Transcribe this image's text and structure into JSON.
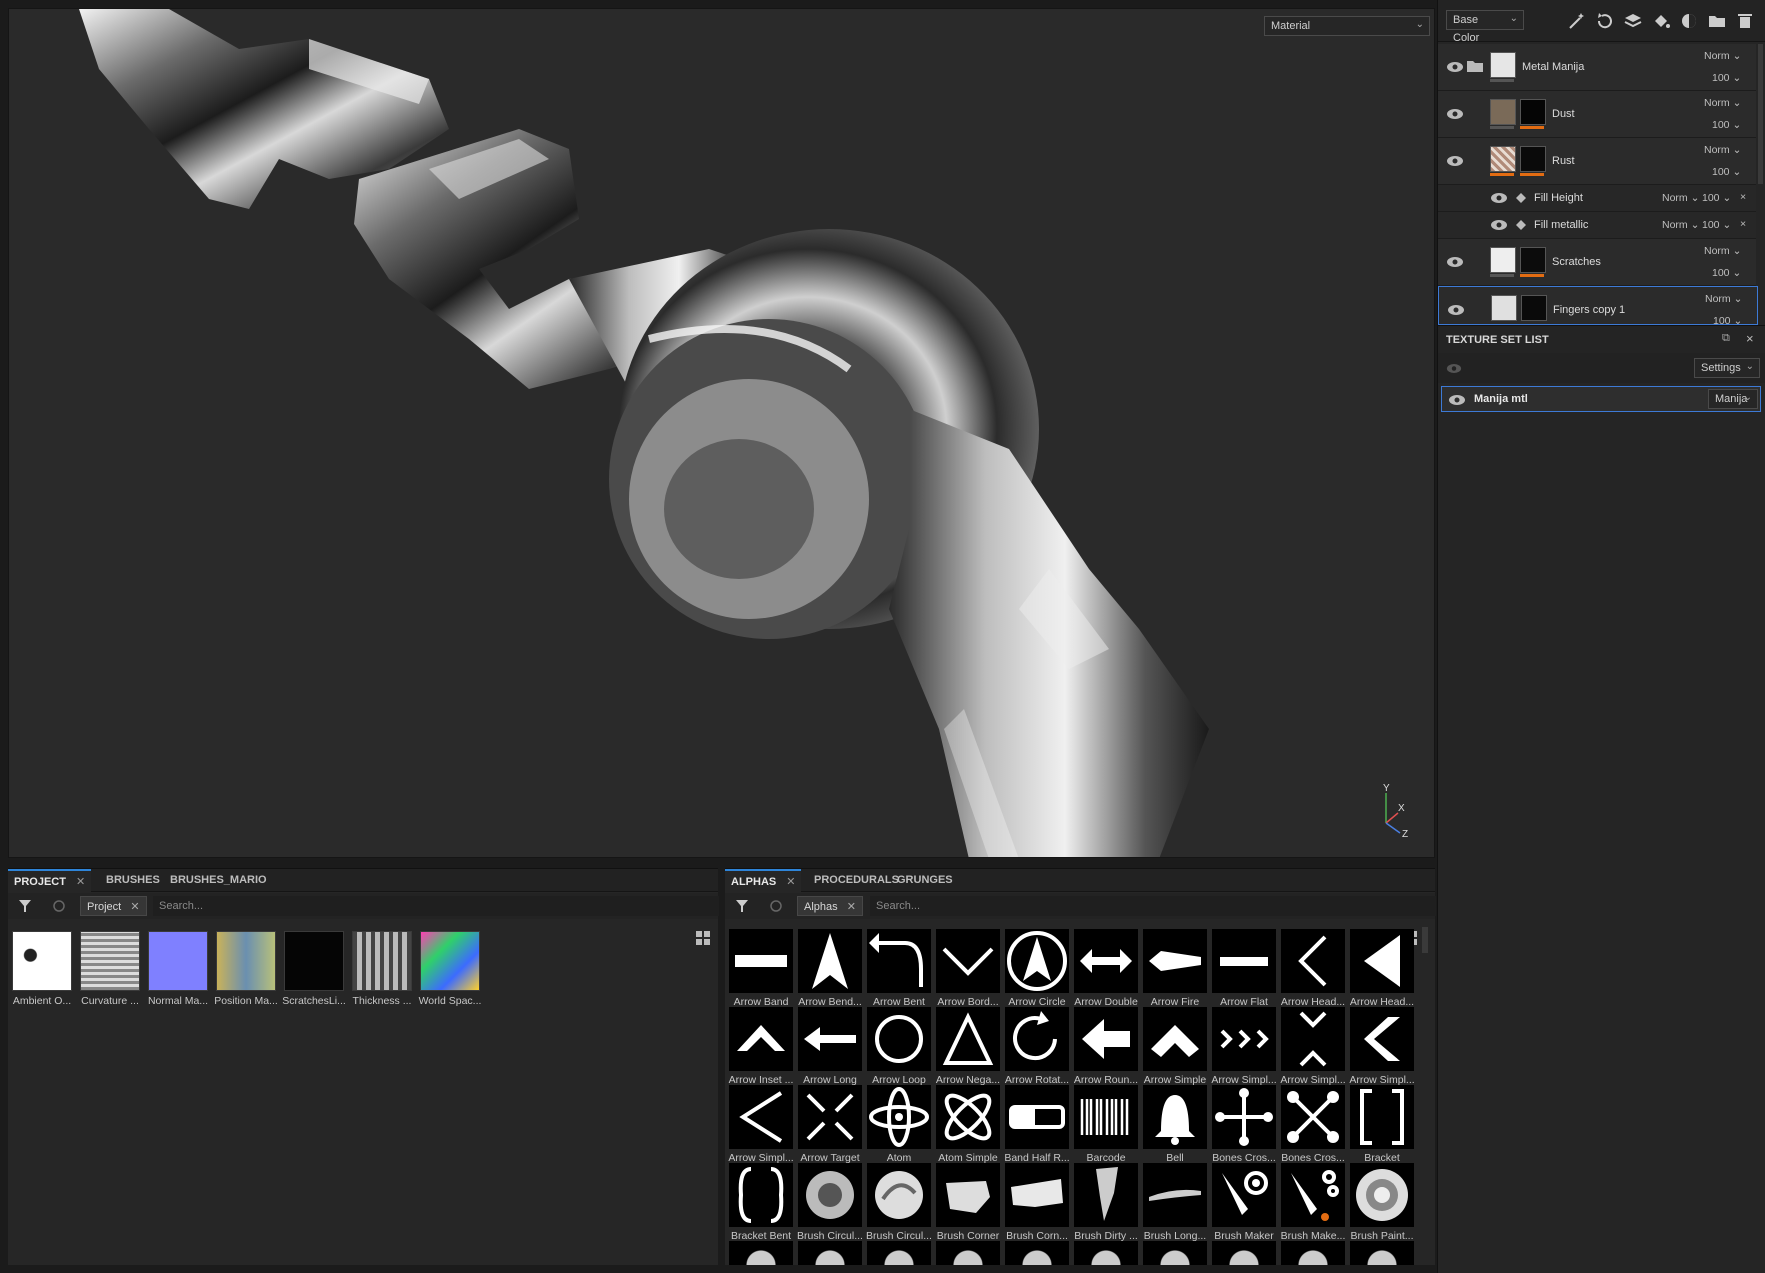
{
  "viewport": {
    "material_dropdown": "Material",
    "axis_labels": {
      "y": "Y",
      "x": "X",
      "z": "Z"
    }
  },
  "layers_panel": {
    "channel_dropdown": "Base Color",
    "toolbar_icons": [
      "magic-wand-icon",
      "refresh-icon",
      "add-layer-icon",
      "fill-bucket-icon",
      "mask-icon",
      "add-folder-icon",
      "trash-icon"
    ],
    "layers": [
      {
        "name": "Metal Manija",
        "blend": "Norm",
        "opacity": "100",
        "type": "folder"
      },
      {
        "name": "Dust",
        "blend": "Norm",
        "opacity": "100",
        "type": "layer"
      },
      {
        "name": "Rust",
        "blend": "Norm",
        "opacity": "100",
        "type": "layer"
      },
      {
        "name": "Fill Height",
        "blend": "Norm",
        "opacity": "100",
        "type": "effect"
      },
      {
        "name": "Fill metallic",
        "blend": "Norm",
        "opacity": "100",
        "type": "effect"
      },
      {
        "name": "Scratches",
        "blend": "Norm",
        "opacity": "100",
        "type": "layer"
      },
      {
        "name": "Fingers copy 1",
        "blend": "Norm",
        "opacity": "100",
        "type": "layer"
      }
    ]
  },
  "texture_set_list": {
    "title": "TEXTURE SET LIST",
    "settings_label": "Settings",
    "set_name": "Manija mtl",
    "set_dropdown": "Manija"
  },
  "project_dock": {
    "tabs": [
      "PROJECT",
      "BRUSHES",
      "BRUSHES_MARIO"
    ],
    "filter_chip": "Project",
    "search_placeholder": "Search...",
    "items": [
      "Ambient O...",
      "Curvature ...",
      "Normal Ma...",
      "Position Ma...",
      "ScratchesLi...",
      "Thickness ...",
      "World Spac..."
    ]
  },
  "alphas_dock": {
    "tabs": [
      "ALPHAS",
      "PROCEDURALS",
      "GRUNGES"
    ],
    "filter_chip": "Alphas",
    "search_placeholder": "Search...",
    "items": [
      "Arrow Band",
      "Arrow Bend...",
      "Arrow Bent",
      "Arrow Bord...",
      "Arrow Circle",
      "Arrow Double",
      "Arrow Fire",
      "Arrow Flat",
      "Arrow Head...",
      "Arrow Head...",
      "Arrow Inset ...",
      "Arrow Long",
      "Arrow Loop",
      "Arrow Nega...",
      "Arrow Rotat...",
      "Arrow Roun...",
      "Arrow Simple",
      "Arrow Simpl...",
      "Arrow Simpl...",
      "Arrow Simpl...",
      "Arrow Simpl...",
      "Arrow Target",
      "Atom",
      "Atom Simple",
      "Band Half R...",
      "Barcode",
      "Bell",
      "Bones Cros...",
      "Bones Cros...",
      "Bracket",
      "Bracket Bent",
      "Brush Circul...",
      "Brush Circul...",
      "Brush Corner",
      "Brush Corn...",
      "Brush Dirty ...",
      "Brush Long...",
      "Brush Maker",
      "Brush Make...",
      "Brush Paint..."
    ]
  }
}
